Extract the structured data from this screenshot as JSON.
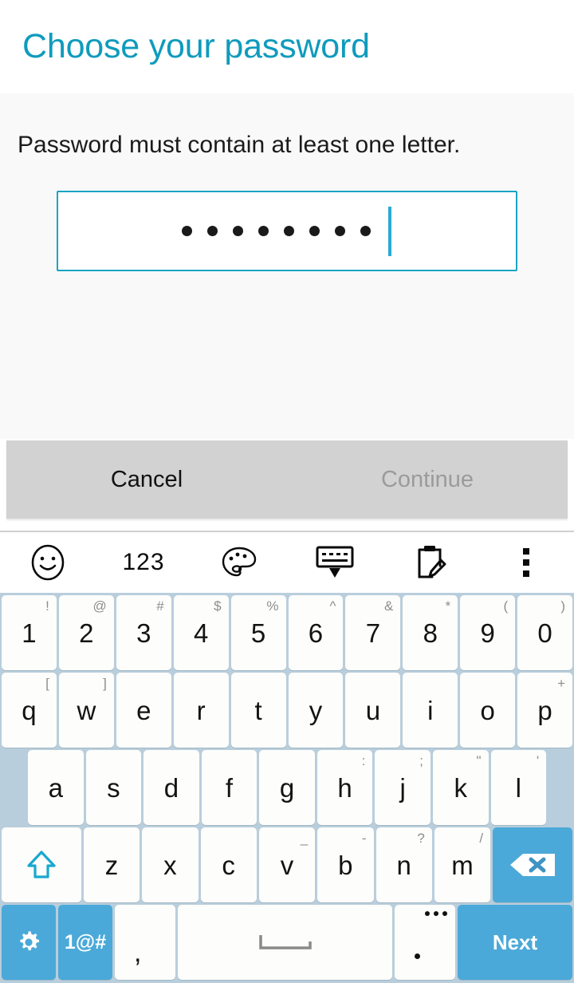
{
  "header": {
    "title": "Choose your password"
  },
  "content": {
    "message": "Password must contain at least one letter.",
    "password_field": {
      "name": "password-input",
      "masked_char_count": 8,
      "caret_visible": true,
      "border_color": "#19a4c4"
    }
  },
  "buttonbar": {
    "cancel_label": "Cancel",
    "continue_label": "Continue",
    "continue_enabled": false,
    "background": "#d2d2d2"
  },
  "keyboard": {
    "background": "#b9cedc",
    "key_color": "#fdfdfb",
    "accent_color": "#4aa9d8",
    "toolbar": [
      {
        "name": "emoji-icon",
        "label": ""
      },
      {
        "name": "numbers-123-icon",
        "label": "123"
      },
      {
        "name": "palette-icon",
        "label": ""
      },
      {
        "name": "hide-keyboard-icon",
        "label": ""
      },
      {
        "name": "clipboard-edit-icon",
        "label": ""
      },
      {
        "name": "overflow-menu-icon",
        "label": ""
      }
    ],
    "rows": [
      [
        {
          "main": "1",
          "sup": "!"
        },
        {
          "main": "2",
          "sup": "@"
        },
        {
          "main": "3",
          "sup": "#"
        },
        {
          "main": "4",
          "sup": "$"
        },
        {
          "main": "5",
          "sup": "%"
        },
        {
          "main": "6",
          "sup": "^"
        },
        {
          "main": "7",
          "sup": "&"
        },
        {
          "main": "8",
          "sup": "*"
        },
        {
          "main": "9",
          "sup": "("
        },
        {
          "main": "0",
          "sup": ")"
        }
      ],
      [
        {
          "main": "q",
          "sup": "["
        },
        {
          "main": "w",
          "sup": "]"
        },
        {
          "main": "e",
          "sup": ""
        },
        {
          "main": "r",
          "sup": ""
        },
        {
          "main": "t",
          "sup": ""
        },
        {
          "main": "y",
          "sup": ""
        },
        {
          "main": "u",
          "sup": ""
        },
        {
          "main": "i",
          "sup": ""
        },
        {
          "main": "o",
          "sup": ""
        },
        {
          "main": "p",
          "sup": "+"
        }
      ],
      [
        {
          "main": "a",
          "sup": ""
        },
        {
          "main": "s",
          "sup": ""
        },
        {
          "main": "d",
          "sup": ""
        },
        {
          "main": "f",
          "sup": ""
        },
        {
          "main": "g",
          "sup": ""
        },
        {
          "main": "h",
          "sup": ":"
        },
        {
          "main": "j",
          "sup": ";"
        },
        {
          "main": "k",
          "sup": "\""
        },
        {
          "main": "l",
          "sup": "'"
        }
      ],
      [
        {
          "main": "z",
          "sup": ""
        },
        {
          "main": "x",
          "sup": ""
        },
        {
          "main": "c",
          "sup": ""
        },
        {
          "main": "v",
          "sup": "_"
        },
        {
          "main": "b",
          "sup": "-"
        },
        {
          "main": "n",
          "sup": "?"
        },
        {
          "main": "m",
          "sup": "/"
        }
      ]
    ],
    "shift_key": {
      "name": "shift-key",
      "label": ""
    },
    "backspace_key": {
      "name": "backspace-key",
      "label": ""
    },
    "gear_key": {
      "name": "settings-key",
      "label": ""
    },
    "symbols_key": {
      "name": "symbols-key",
      "label": "1@#"
    },
    "comma_key": {
      "name": "comma-key",
      "label": ","
    },
    "space_key": {
      "name": "space-key",
      "label": ""
    },
    "period_key": {
      "name": "period-key",
      "label": "."
    },
    "enter_key": {
      "name": "enter-key",
      "label": "Next"
    }
  }
}
